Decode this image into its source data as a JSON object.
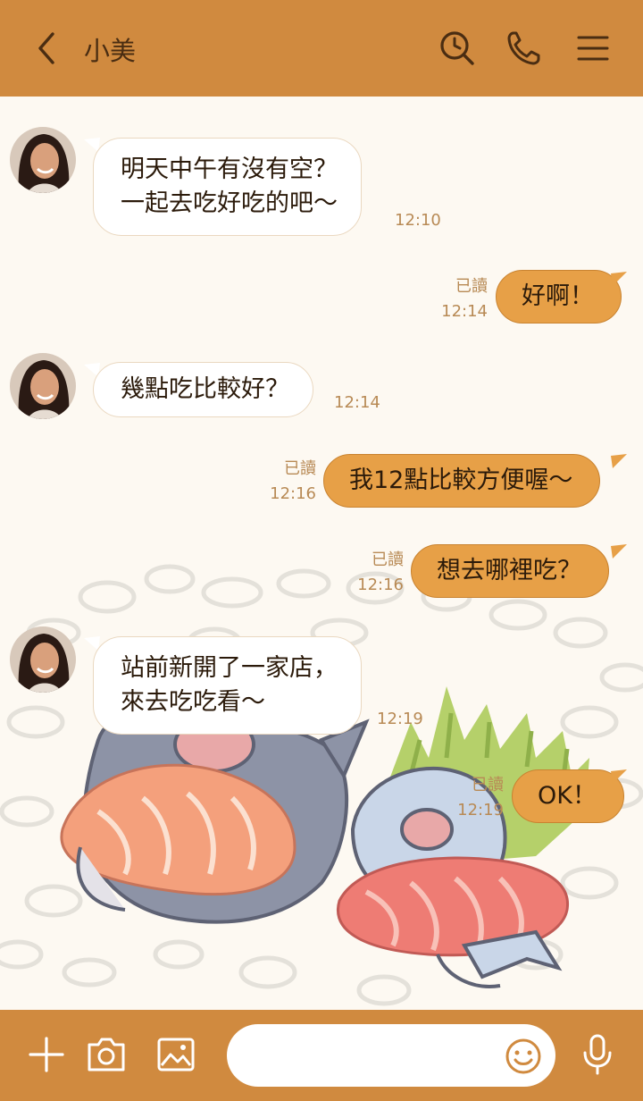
{
  "header": {
    "title": "小美",
    "back_icon": "chevron-left-icon",
    "search_icon": "search-icon",
    "phone_icon": "phone-icon",
    "menu_icon": "menu-icon"
  },
  "messages": [
    {
      "from": "contact",
      "lines": [
        "明天中午有沒有空？",
        "一起去吃好吃的吧～"
      ],
      "time": "12:10"
    },
    {
      "from": "me",
      "lines": [
        "好啊！"
      ],
      "read": "已讀",
      "time": "12:14"
    },
    {
      "from": "contact",
      "lines": [
        "幾點吃比較好？"
      ],
      "time": "12:14"
    },
    {
      "from": "me",
      "lines": [
        "我12點比較方便喔～"
      ],
      "read": "已讀",
      "time": "12:16"
    },
    {
      "from": "me",
      "lines": [
        "想去哪裡吃？"
      ],
      "read": "已讀",
      "time": "12:16"
    },
    {
      "from": "contact",
      "lines": [
        "站前新開了一家店，",
        "來去吃吃看～"
      ],
      "time": "12:19"
    },
    {
      "from": "me",
      "lines": [
        "OK！"
      ],
      "read": "已讀",
      "time": "12:19"
    }
  ],
  "footer": {
    "plus_icon": "plus-icon",
    "camera_icon": "camera-icon",
    "image_icon": "image-icon",
    "emoji_icon": "smiley-icon",
    "mic_icon": "microphone-icon",
    "input_value": ""
  },
  "colors": {
    "header_bg": "#d08a3f",
    "chat_bg": "#fdf9f2",
    "outgoing_bubble": "#e7a047",
    "incoming_bubble": "#ffffff",
    "meta_text": "#b88a55"
  }
}
